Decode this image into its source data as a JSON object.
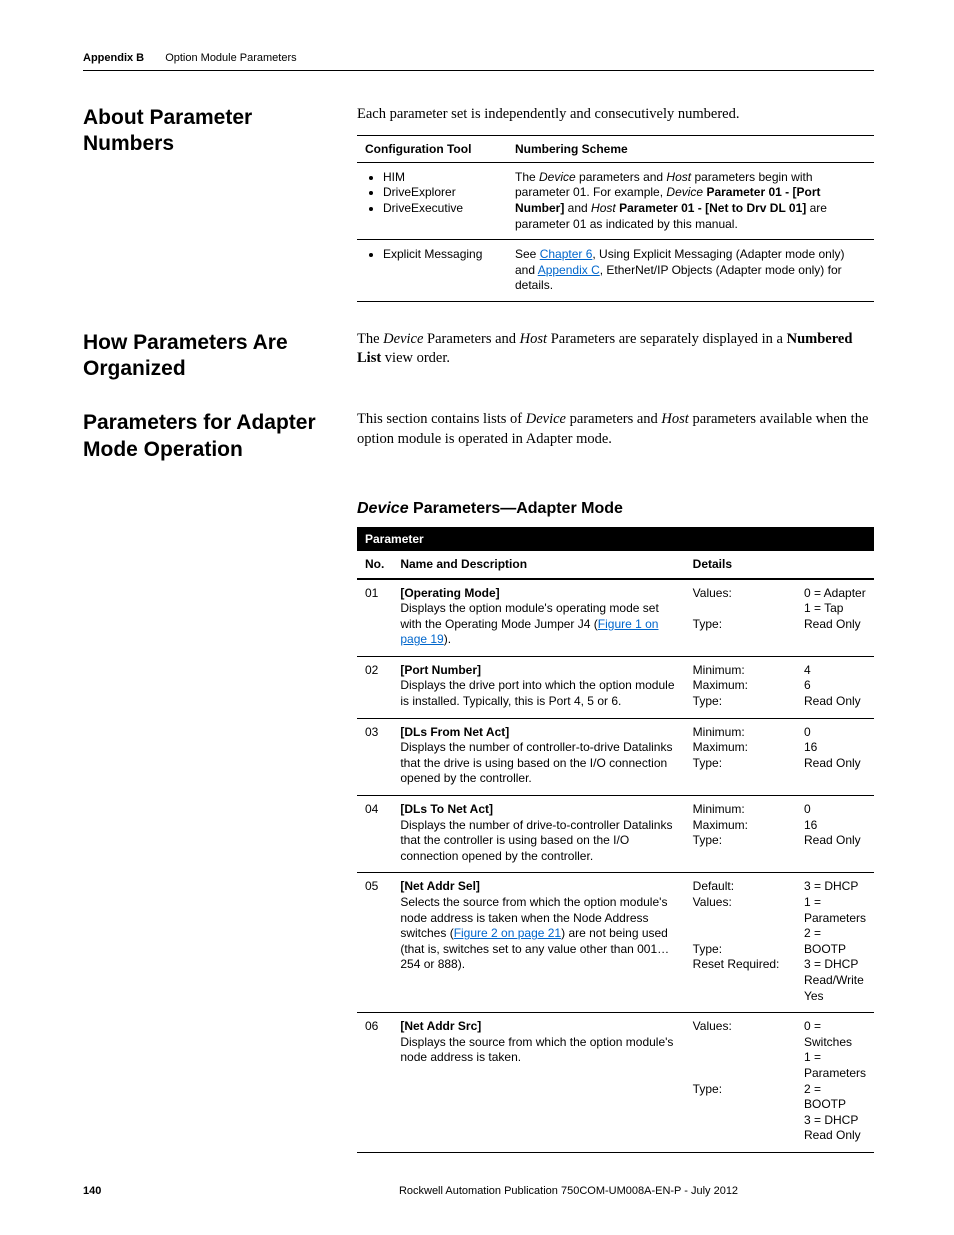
{
  "header": {
    "appendix": "Appendix B",
    "title": "Option Module Parameters"
  },
  "s1": {
    "title": "About Parameter Numbers",
    "intro": "Each parameter set is independently and consecutively numbered.",
    "th1": "Configuration Tool",
    "th2": "Numbering Scheme",
    "r1": {
      "b1": "HIM",
      "b2": "DriveExplorer",
      "b3": "DriveExecutive",
      "t1": "The ",
      "t2": "Device",
      "t3": " parameters and ",
      "t4": "Host",
      "t5": " parameters begin with parameter 01. For example, ",
      "t6": "Device",
      "t7": " ",
      "t8": "Parameter 01 - [Port Number]",
      "t9": " and ",
      "t10": "Host",
      "t11": " ",
      "t12": "Parameter 01 - [Net to Drv DL 01]",
      "t13": " are parameter 01 as indicated by this manual."
    },
    "r2": {
      "b1": "Explicit Messaging",
      "t1": "See ",
      "l1": "Chapter 6",
      "t2": ", Using Explicit Messaging (Adapter mode only) and ",
      "l2": "Appendix C",
      "t3": ", EtherNet/IP Objects (Adapter mode only) for details."
    }
  },
  "s2": {
    "title": "How Parameters Are Organized",
    "t1": "The ",
    "t2": "Device",
    "t3": " Parameters and ",
    "t4": "Host",
    "t5": " Parameters are separately displayed in a ",
    "t6": "Numbered List",
    "t7": " view order."
  },
  "s3": {
    "title": "Parameters for Adapter Mode Operation",
    "t1": "This section contains lists of ",
    "t2": "Device",
    "t3": " parameters and ",
    "t4": "Host",
    "t5": " parameters available when the option module is operated in Adapter mode."
  },
  "sub": {
    "ital": "Device",
    "rest": " Parameters—Adapter Mode"
  },
  "pt": {
    "h_param": "Parameter",
    "h_no": "No.",
    "h_name": "Name and Description",
    "h_details": "Details",
    "r01": {
      "no": "01",
      "name": "[Operating Mode]",
      "d1": "Displays the option module's operating mode set with the Operating Mode Jumper J4 (",
      "l": "Figure 1 on page 19",
      "d2": ").",
      "lbl": "Values:\n\nType:",
      "val": "0 = Adapter\n1 = Tap\nRead Only"
    },
    "r02": {
      "no": "02",
      "name": "[Port Number]",
      "d": "Displays the drive port into which the option module is installed. Typically, this is Port 4, 5 or 6.",
      "lbl": "Minimum:\nMaximum:\nType:",
      "val": "4\n6\nRead Only"
    },
    "r03": {
      "no": "03",
      "name": "[DLs From Net Act]",
      "d": "Displays the number of controller-to-drive Datalinks that the drive is using based on the I/O connection opened by the controller.",
      "lbl": "Minimum:\nMaximum:\nType:",
      "val": "0\n16\nRead Only"
    },
    "r04": {
      "no": "04",
      "name": "[DLs To Net Act]",
      "d": "Displays the number of drive-to-controller Datalinks that the controller is using based on the I/O connection opened by the controller.",
      "lbl": "Minimum:\nMaximum:\nType:",
      "val": "0\n16\nRead Only"
    },
    "r05": {
      "no": "05",
      "name": "[Net Addr Sel]",
      "d1": "Selects the source from which the option module's node address is taken when the Node Address switches (",
      "l": "Figure 2 on page 21",
      "d2": ") are not being used (that is, switches set to any value other than 001…254 or 888).",
      "lbl": "Default:\nValues:\n\n\nType:\nReset Required:",
      "val": "3 = DHCP\n1 = Parameters\n2 = BOOTP\n3 = DHCP\nRead/Write\nYes"
    },
    "r06": {
      "no": "06",
      "name": "[Net Addr Src]",
      "d": "Displays the source from which the option module's node address is taken.",
      "lbl": "Values:\n\n\n\nType:",
      "val": "0 = Switches\n1 = Parameters\n2 = BOOTP\n3 = DHCP\nRead Only"
    }
  },
  "footer": {
    "page": "140",
    "pub": "Rockwell Automation Publication 750COM-UM008A-EN-P - July 2012"
  },
  "chart_data": {
    "type": "table",
    "title": "Device Parameters—Adapter Mode",
    "columns": [
      "No.",
      "Name",
      "Description",
      "Details"
    ],
    "rows": [
      {
        "no": "01",
        "name": "[Operating Mode]",
        "desc": "Displays the option module's operating mode set with the Operating Mode Jumper J4 (Figure 1 on page 19).",
        "details": {
          "Values": [
            "0 = Adapter",
            "1 = Tap"
          ],
          "Type": "Read Only"
        }
      },
      {
        "no": "02",
        "name": "[Port Number]",
        "desc": "Displays the drive port into which the option module is installed. Typically, this is Port 4, 5 or 6.",
        "details": {
          "Minimum": 4,
          "Maximum": 6,
          "Type": "Read Only"
        }
      },
      {
        "no": "03",
        "name": "[DLs From Net Act]",
        "desc": "Displays the number of controller-to-drive Datalinks that the drive is using based on the I/O connection opened by the controller.",
        "details": {
          "Minimum": 0,
          "Maximum": 16,
          "Type": "Read Only"
        }
      },
      {
        "no": "04",
        "name": "[DLs To Net Act]",
        "desc": "Displays the number of drive-to-controller Datalinks that the controller is using based on the I/O connection opened by the controller.",
        "details": {
          "Minimum": 0,
          "Maximum": 16,
          "Type": "Read Only"
        }
      },
      {
        "no": "05",
        "name": "[Net Addr Sel]",
        "desc": "Selects the source from which the option module's node address is taken when the Node Address switches (Figure 2 on page 21) are not being used (that is, switches set to any value other than 001…254 or 888).",
        "details": {
          "Default": "3 = DHCP",
          "Values": [
            "1 = Parameters",
            "2 = BOOTP",
            "3 = DHCP"
          ],
          "Type": "Read/Write",
          "Reset Required": "Yes"
        }
      },
      {
        "no": "06",
        "name": "[Net Addr Src]",
        "desc": "Displays the source from which the option module's node address is taken.",
        "details": {
          "Values": [
            "0 = Switches",
            "1 = Parameters",
            "2 = BOOTP",
            "3 = DHCP"
          ],
          "Type": "Read Only"
        }
      }
    ]
  }
}
